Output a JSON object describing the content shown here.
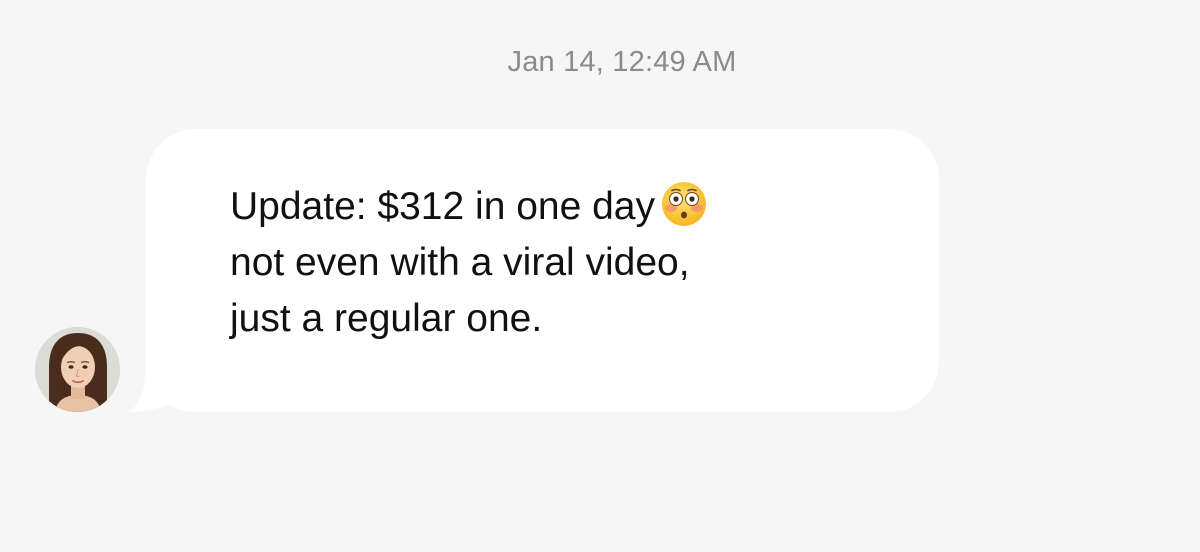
{
  "conversation": {
    "timestamp": "Jan 14, 12:49 AM",
    "message": {
      "lines": [
        "Update: $312 in one day",
        "not even with a viral video,",
        "just a regular one."
      ],
      "emoji": "flushed-face-emoji",
      "bubble_color": "#ffffff"
    },
    "sender": {
      "avatar": "avatar-photo-woman"
    }
  },
  "theme": {
    "background": "#f6f6f6",
    "timestamp_color": "#8a8a8f",
    "text_color": "#111111"
  }
}
